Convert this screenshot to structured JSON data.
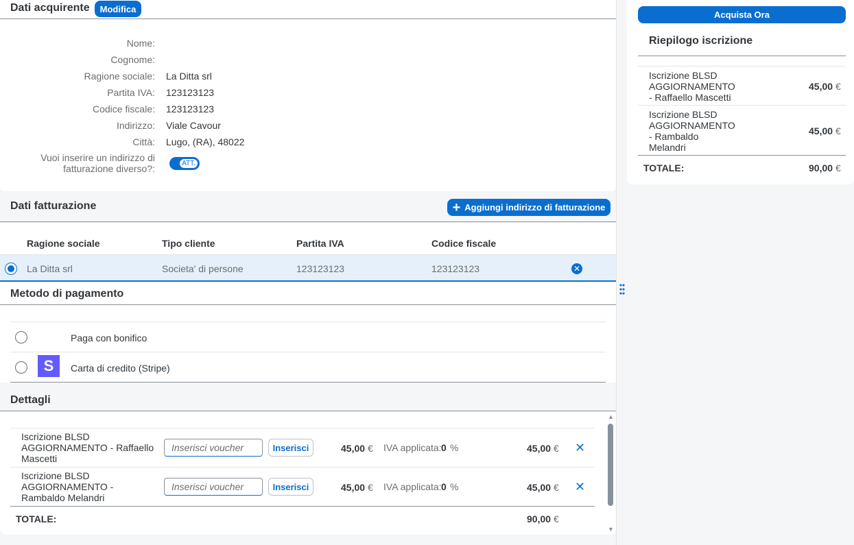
{
  "buyer": {
    "title": "Dati acquirente",
    "edit_label": "Modifica",
    "fields": [
      {
        "label": "Nome:",
        "value": ""
      },
      {
        "label": "Cognome:",
        "value": ""
      },
      {
        "label": "Ragione sociale:",
        "value": "La Ditta srl"
      },
      {
        "label": "Partita IVA:",
        "value": "123123123"
      },
      {
        "label": "Codice fiscale:",
        "value": "123123123"
      },
      {
        "label": "Indirizzo:",
        "value": "Viale Cavour"
      },
      {
        "label": "Città:",
        "value": "Lugo, (RA), 48022"
      }
    ],
    "alt_billing_label_1": "Vuoi inserire un indirizzo di",
    "alt_billing_label_2": "fatturazione diverso?:",
    "toggle_text": "ATT."
  },
  "billing": {
    "title": "Dati fatturazione",
    "add_label": "Aggiungi indirizzo di fatturazione",
    "columns": [
      "Ragione sociale",
      "Tipo cliente",
      "Partita IVA",
      "Codice fiscale"
    ],
    "rows": [
      {
        "ragione_sociale": "La Ditta srl",
        "tipo_cliente": "Societa' di persone",
        "partita_iva": "123123123",
        "codice_fiscale": "123123123",
        "selected": true
      }
    ]
  },
  "payment": {
    "title": "Metodo di pagamento",
    "options": [
      {
        "label": "Paga con bonifico",
        "icon": "none"
      },
      {
        "label": "Carta di credito (Stripe)",
        "icon": "stripe-icon"
      }
    ]
  },
  "details": {
    "title": "Dettagli",
    "voucher_placeholder": "Inserisci voucher",
    "insert_label": "Inserisci",
    "iva_label": "IVA applicata:",
    "items": [
      {
        "line1": "Iscrizione BLSD",
        "line2": "AGGIORNAMENTO - Raffaello",
        "line3": "Mascetti",
        "price": "45,00",
        "currency": "€",
        "iva": "0",
        "iva_unit": "%",
        "total": "45,00"
      },
      {
        "line1": "Iscrizione BLSD",
        "line2": "AGGIORNAMENTO -",
        "line3": "Rambaldo Melandri",
        "price": "45,00",
        "currency": "€",
        "iva": "0",
        "iva_unit": "%",
        "total": "45,00"
      }
    ],
    "total_label": "TOTALE:",
    "total_value": "90,00",
    "total_currency": "€"
  },
  "summary": {
    "buy_label": "Acquista Ora",
    "title": "Riepilogo iscrizione",
    "items": [
      {
        "lines": [
          "Iscrizione BLSD",
          "AGGIORNAMENTO",
          "- Raffaello Mascetti"
        ],
        "price": "45,00",
        "currency": "€"
      },
      {
        "lines": [
          "Iscrizione BLSD",
          "AGGIORNAMENTO",
          "- Rambaldo",
          "Melandri"
        ],
        "price": "45,00",
        "currency": "€"
      }
    ],
    "total_label": "TOTALE:",
    "total_value": "90,00",
    "total_currency": "€"
  },
  "colors": {
    "accent": "#0a6ed1",
    "stripe": "#635bff",
    "selected_row": "#e5f0fa"
  }
}
